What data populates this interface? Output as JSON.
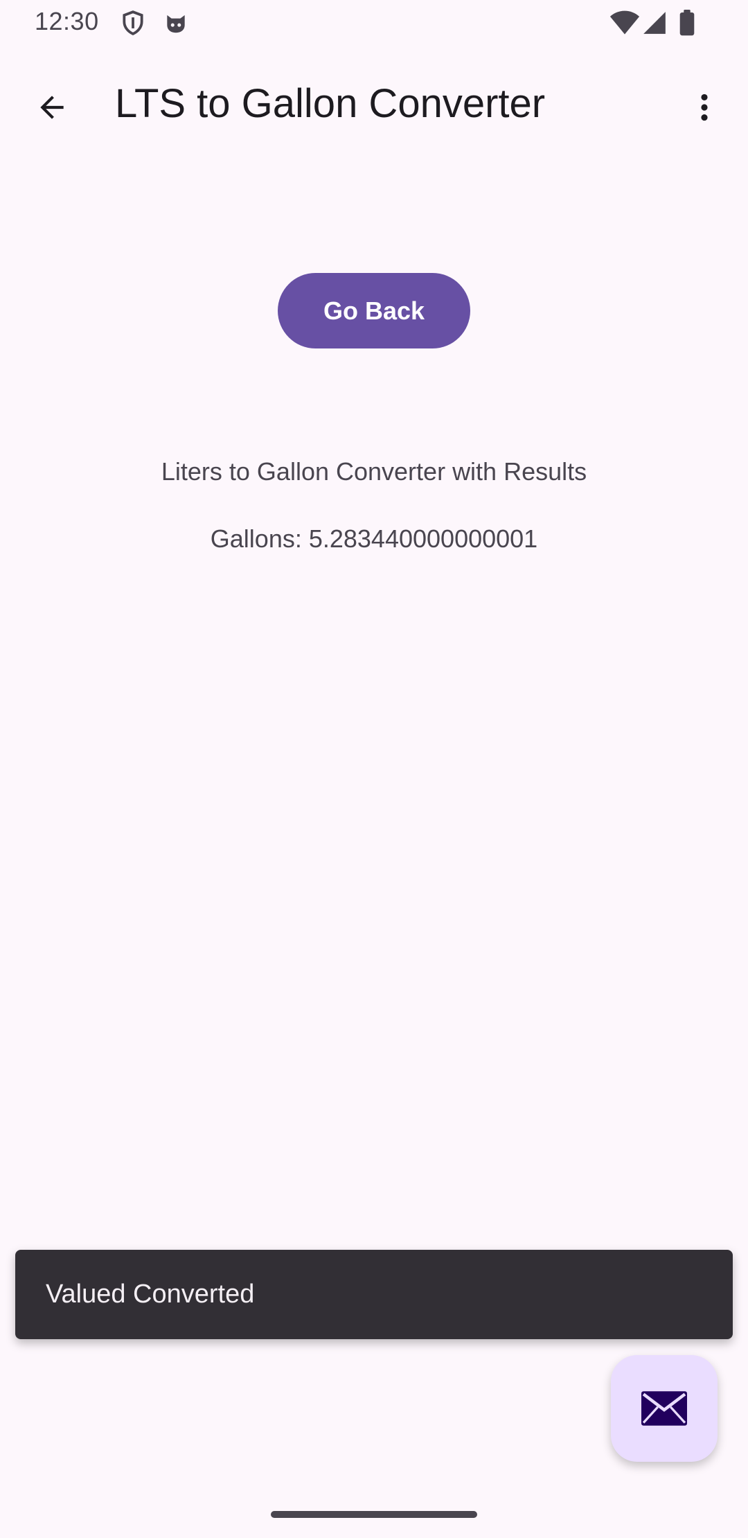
{
  "status_bar": {
    "time": "12:30",
    "icons": [
      "shield-icon",
      "cat-face-icon",
      "wifi-icon",
      "cell-signal-icon",
      "battery-icon"
    ]
  },
  "app_bar": {
    "title": "LTS to Gallon Converter",
    "back_icon": "arrow-back-icon",
    "menu_icon": "more-vert-icon"
  },
  "main": {
    "go_back_label": "Go Back",
    "heading": "Liters to Gallon Converter with Results",
    "result": "Gallons: 5.283440000000001"
  },
  "snackbar": {
    "message": "Valued Converted"
  },
  "fab": {
    "icon": "email-icon"
  },
  "colors": {
    "background": "#fdf7fc",
    "primary": "#6750a4",
    "fab_container": "#eaddff",
    "snackbar": "#322f35"
  }
}
